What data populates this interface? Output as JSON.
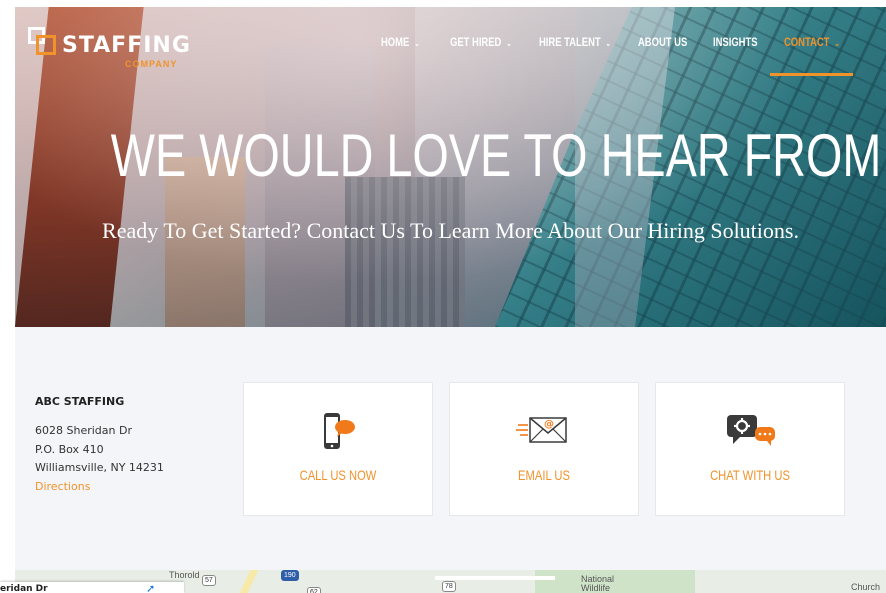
{
  "brand": {
    "name": "STAFFING",
    "tagline": "COMPANY",
    "accent_color": "#f0932b"
  },
  "nav": {
    "items": [
      {
        "label": "HOME",
        "has_dropdown": true
      },
      {
        "label": "GET HIRED",
        "has_dropdown": true
      },
      {
        "label": "HIRE TALENT",
        "has_dropdown": true
      },
      {
        "label": "ABOUT US",
        "has_dropdown": false
      },
      {
        "label": "INSIGHTS",
        "has_dropdown": false
      },
      {
        "label": "CONTACT",
        "has_dropdown": true,
        "active": true
      }
    ],
    "chevron": "⌄"
  },
  "hero": {
    "title": "WE WOULD LOVE TO HEAR FROM YOU",
    "subtitle": "Ready To Get Started? Contact Us To Learn More About Our Hiring Solutions."
  },
  "address": {
    "company": "ABC STAFFING",
    "line1": "6028 Sheridan Dr",
    "line2": "P.O. Box 410",
    "line3": "Williamsville, NY 14231",
    "directions_label": "Directions"
  },
  "cards": {
    "call": {
      "label": "CALL US NOW",
      "icon": "phone-chat-icon"
    },
    "email": {
      "label": "EMAIL US",
      "icon": "email-envelope-icon"
    },
    "chat": {
      "label": "CHAT WITH US",
      "icon": "chat-bubbles-icon"
    }
  },
  "map": {
    "labels": {
      "thorold": "Thorold",
      "national": "National",
      "wildlife": "Wildlife",
      "church": "Church"
    },
    "shields": {
      "s1": "57",
      "s2": "190",
      "s3": "78",
      "s4": "62"
    },
    "card_text": "eridan Dr"
  }
}
